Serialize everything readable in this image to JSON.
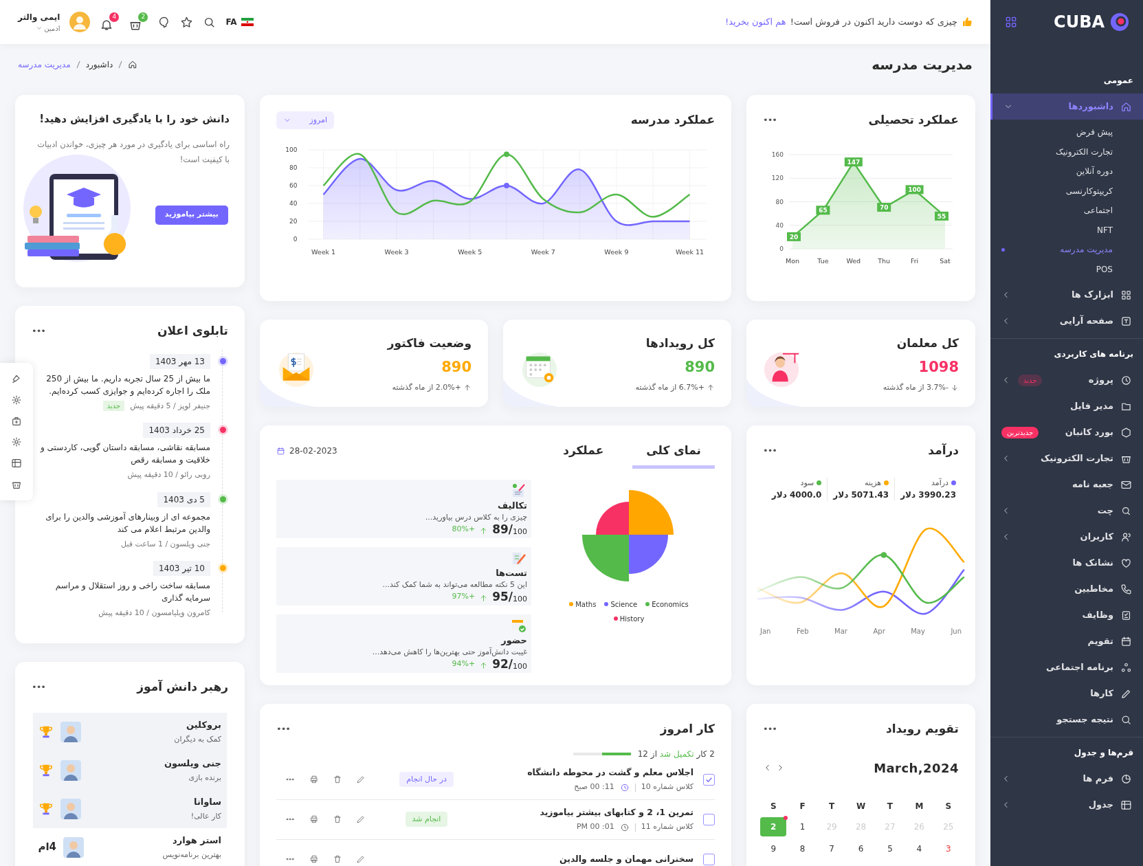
{
  "sidebar": {
    "brand": "CUBA",
    "sections": [
      {
        "title": "عمومی",
        "items": [
          {
            "label": "داشبوردها",
            "selected": true,
            "expanded": true,
            "children": [
              {
                "label": "پیش فرض",
                "selected": false
              },
              {
                "label": "تجارت الکترونیک",
                "selected": false
              },
              {
                "label": "دوره آنلاین",
                "selected": false
              },
              {
                "label": "کریپتوکارنسی",
                "selected": false
              },
              {
                "label": "اجتماعی",
                "selected": false
              },
              {
                "label": "NFT",
                "selected": false
              },
              {
                "label": "مدیریت مدرسه",
                "selected": true
              },
              {
                "label": "POS",
                "selected": false
              }
            ]
          },
          {
            "label": "ابزارک ها",
            "selected": false,
            "expanded": false
          },
          {
            "label": "صفحه آرایی",
            "selected": false,
            "expanded": false
          }
        ]
      },
      {
        "title": "برنامه های کاربردی",
        "items": [
          {
            "label": "پروژه",
            "selected": false,
            "expanded": false,
            "badge": {
              "text": "جدید",
              "kind": "soft"
            }
          },
          {
            "label": "مدیر فایل",
            "selected": false
          },
          {
            "label": "بورد کانبان",
            "selected": false,
            "badge": {
              "text": "جدیدترین",
              "kind": "solid"
            }
          },
          {
            "label": "تجارت الکترونیک",
            "selected": false,
            "expanded": false
          },
          {
            "label": "جعبه نامه",
            "selected": false
          },
          {
            "label": "چت",
            "selected": false,
            "expanded": false
          },
          {
            "label": "کاربران",
            "selected": false,
            "expanded": false
          },
          {
            "label": "نشانک ها",
            "selected": false
          },
          {
            "label": "مخاطبین",
            "selected": false
          },
          {
            "label": "وظایف",
            "selected": false
          },
          {
            "label": "تقویم",
            "selected": false
          },
          {
            "label": "برنامه اجتماعی",
            "selected": false
          },
          {
            "label": "کارها",
            "selected": false
          },
          {
            "label": "نتیجه جستجو",
            "selected": false
          }
        ]
      },
      {
        "title": "فرم‌ها و جدول",
        "items": [
          {
            "label": "فرم ها",
            "selected": false,
            "expanded": false
          },
          {
            "label": "جدول",
            "selected": false,
            "expanded": false
          }
        ]
      }
    ]
  },
  "topbar": {
    "promo": {
      "text": "چیزی که دوست دارید اکنون در فروش است!",
      "link": "هم اکنون بخرید!"
    },
    "language": "FA",
    "notifications": "4",
    "cart": "2",
    "user": {
      "name": "ایمی والتر",
      "role": "ادمین"
    }
  },
  "page": {
    "title": "مدیریت مدرسه",
    "breadcrumbs": [
      {
        "label": "داشبورد",
        "selected": false
      },
      {
        "label": "مدیریت مدرسه",
        "selected": true
      }
    ]
  },
  "academic": {
    "title": "عملکرد تحصیلی",
    "menu": "•••",
    "chart_data": {
      "type": "area",
      "categories": [
        "Mon",
        "Tue",
        "Wed",
        "Thu",
        "Fri",
        "Sat"
      ],
      "ylim": [
        0,
        160
      ],
      "yticks": [
        0,
        40,
        80,
        120,
        160
      ],
      "grid": true,
      "data_labels": true,
      "series": [
        {
          "color": "#54ba4a",
          "values": [
            20,
            65,
            147,
            70,
            100,
            55
          ]
        }
      ]
    }
  },
  "school": {
    "title": "عملکرد مدرسه",
    "filter": "امروز",
    "chart_data": {
      "type": "area",
      "categories": [
        "Week 1",
        null,
        "Week 3",
        null,
        "Week 5",
        null,
        "Week 7",
        null,
        "Week 9",
        null,
        "Week 11"
      ],
      "ylim": [
        0,
        100
      ],
      "yticks": [
        0,
        20,
        40,
        60,
        80,
        100
      ],
      "grid": true,
      "series": [
        {
          "type": "area",
          "color": "#7366ff",
          "values": [
            50,
            90,
            55,
            65,
            45,
            60,
            40,
            78,
            20,
            20,
            20
          ]
        },
        {
          "type": "line",
          "color": "#54ba4a",
          "values": [
            60,
            95,
            30,
            43,
            42,
            95,
            45,
            30,
            50,
            25,
            50
          ]
        }
      ]
    }
  },
  "stats": [
    {
      "kind": "teachers",
      "title": "کل معلمان",
      "value": "1098",
      "color": "#f73164",
      "change": "-3.7% از ماه گذشته",
      "rising": false
    },
    {
      "kind": "events",
      "title": "کل رویدادها",
      "value": "890",
      "color": "#54ba4a",
      "change": "+6.7% از ماه گذشته",
      "rising": true
    },
    {
      "kind": "invoice",
      "title": "وضعیت فاکتور",
      "value": "890",
      "color": "#ffaa05",
      "change": "+2.0% از ماه گذشته",
      "rising": true
    }
  ],
  "learn": {
    "title": "دانش خود را با یادگیری افزایش دهید!",
    "text": "راه اساسی برای یادگیری در مورد هر چیزی، خواندن ادبیات با کیفیت است!",
    "button": "بیشتر بیاموزید"
  },
  "notice_board": {
    "title": "تابلوی اعلان",
    "menu": "•••",
    "items": [
      {
        "date": "13 مهر 1403",
        "text": "ما بیش از 25 سال تجربه داریم. ما بیش از 250 ملک را اجاره کرده‌ایم و جوایزی کسب کرده‌ایم.",
        "meta": "جنیفر لوپز / 5 دقیقه پیش",
        "badge": "جدید",
        "color": "#7366ff"
      },
      {
        "date": "25 خرداد 1403",
        "text": "مسابقه نقاشی، مسابقه داستان گویی، کاردستی و خلاقیت و مسابقه رقص",
        "meta": "روبی رائو / 10 دقیقه پیش",
        "color": "#f73164"
      },
      {
        "date": "5 دی 1403",
        "text": "مجموعه ای از وبینارهای آموزشی والدین را برای والدین مرتبط اعلام می کند",
        "meta": "جنی ویلسون / 1 ساعت قبل",
        "color": "#54ba4a"
      },
      {
        "date": "10 تیر 1403",
        "text": "مسابقه ساخت راخی و روز استقلال و مراسم سرمایه گذاری",
        "meta": "کامرون ویلیامسون / 10 دقیقه پیش",
        "color": "#ffaa05"
      }
    ]
  },
  "revenue": {
    "title": "درآمد",
    "menu": "•••",
    "legend": [
      {
        "label": "درآمد",
        "value": "3990.23 دلار",
        "color": "#7366ff"
      },
      {
        "label": "هزینه",
        "value": "5071.43 دلار",
        "color": "#ffaa05"
      },
      {
        "label": "سود",
        "value": "4000.0 دلار",
        "color": "#54ba4a"
      }
    ],
    "x_labels": [
      "Jun",
      "May",
      "Apr",
      "Mar",
      "Feb",
      "Jan"
    ]
  },
  "overview": {
    "tabs": [
      {
        "label": "نمای کلی",
        "selected": true
      },
      {
        "label": "عملکرد",
        "selected": false
      }
    ],
    "date": "28-02-2023",
    "legend": [
      {
        "label": "Economics",
        "color": "#54ba4a"
      },
      {
        "label": "Science",
        "color": "#7366ff"
      },
      {
        "label": "Maths",
        "color": "#ffa600"
      },
      {
        "label": "History",
        "color": "#f73164"
      }
    ],
    "subjects": [
      {
        "title": "تکالیف",
        "text": "چیزی را به کلاس درس بیاورید...",
        "score": "89/",
        "out_of": "100",
        "change": "+80%"
      },
      {
        "title": "تست‌ها",
        "text": "این 5 نکته مطالعه می‌تواند به شما کمک کند...",
        "score": "95/",
        "out_of": "100",
        "change": "+97%"
      },
      {
        "title": "حضور",
        "text": "غیبت دانش‌آموز حتی بهترین‌ها را کاهش می‌دهد...",
        "score": "92/",
        "out_of": "100",
        "change": "+94%"
      }
    ]
  },
  "calendar": {
    "title": "تقویم رویداد",
    "menu": "•••",
    "month": "2024,March",
    "weekdays": [
      "S",
      "M",
      "T",
      "W",
      "T",
      "F",
      "S"
    ],
    "weeks": [
      [
        {
          "day": "25",
          "kind": "muted",
          "selected": false,
          "event": false
        },
        {
          "day": "26",
          "kind": "muted",
          "selected": false,
          "event": false
        },
        {
          "day": "27",
          "kind": "muted",
          "selected": false,
          "event": false
        },
        {
          "day": "28",
          "kind": "muted",
          "selected": false,
          "event": false
        },
        {
          "day": "29",
          "kind": "muted",
          "selected": false,
          "event": false
        },
        {
          "day": "1",
          "kind": "normal",
          "selected": false,
          "event": false
        },
        {
          "day": "2",
          "kind": "normal",
          "selected": true,
          "event": true
        }
      ],
      [
        {
          "day": "3",
          "kind": "holiday",
          "selected": false,
          "event": false
        },
        {
          "day": "4",
          "kind": "normal",
          "selected": false,
          "event": false
        },
        {
          "day": "5",
          "kind": "normal",
          "selected": false,
          "event": false
        },
        {
          "day": "6",
          "kind": "normal",
          "selected": false,
          "event": false
        },
        {
          "day": "7",
          "kind": "normal",
          "selected": false,
          "event": false
        },
        {
          "day": "8",
          "kind": "normal",
          "selected": false,
          "event": false
        },
        {
          "day": "9",
          "kind": "normal",
          "selected": false,
          "event": false
        }
      ]
    ]
  },
  "tasks": {
    "title": "کار امروز",
    "menu": "•••",
    "progress": {
      "count": "2 کار",
      "done": "تکمیل شد",
      "total": "از 12",
      "level": 0.5
    },
    "items": [
      {
        "title": "اجلاس معلم و گشت در محوطه دانشگاه",
        "class": "کلاس شماره 10",
        "time": "11: 00 صبح",
        "status": "در حال انجام",
        "done": false,
        "checked": true
      },
      {
        "title": "تمرین 1، 2 و کتابهای بیشتر بیاموزید",
        "class": "کلاس شماره 11",
        "time": "01: 00 PM",
        "status": "انجام شد",
        "done": true,
        "checked": false
      },
      {
        "title": "سخنرانی مهمان و جلسه والدین",
        "checked": false
      }
    ]
  },
  "leaders": {
    "title": "رهبر دانش آموز",
    "menu": "•••",
    "items": [
      {
        "kind": "trophy",
        "name": "بروکلین",
        "note": "کمک به دیگران"
      },
      {
        "kind": "trophy",
        "name": "جنی ویلسون",
        "note": "برنده بازی"
      },
      {
        "kind": "trophy",
        "name": "ساوانا",
        "note": "کار عالی!"
      },
      {
        "kind": "rank",
        "rank": "4ام",
        "name": "استر هوارد",
        "note": "بهترین برنامه‌نویس"
      }
    ]
  }
}
